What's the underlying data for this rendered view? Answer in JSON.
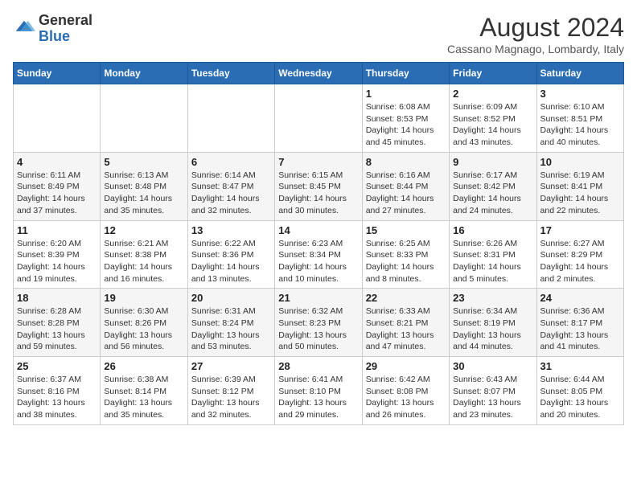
{
  "header": {
    "logo_general": "General",
    "logo_blue": "Blue",
    "month_year": "August 2024",
    "location": "Cassano Magnago, Lombardy, Italy"
  },
  "days_of_week": [
    "Sunday",
    "Monday",
    "Tuesday",
    "Wednesday",
    "Thursday",
    "Friday",
    "Saturday"
  ],
  "weeks": [
    [
      {
        "day": "",
        "info": ""
      },
      {
        "day": "",
        "info": ""
      },
      {
        "day": "",
        "info": ""
      },
      {
        "day": "",
        "info": ""
      },
      {
        "day": "1",
        "info": "Sunrise: 6:08 AM\nSunset: 8:53 PM\nDaylight: 14 hours and 45 minutes."
      },
      {
        "day": "2",
        "info": "Sunrise: 6:09 AM\nSunset: 8:52 PM\nDaylight: 14 hours and 43 minutes."
      },
      {
        "day": "3",
        "info": "Sunrise: 6:10 AM\nSunset: 8:51 PM\nDaylight: 14 hours and 40 minutes."
      }
    ],
    [
      {
        "day": "4",
        "info": "Sunrise: 6:11 AM\nSunset: 8:49 PM\nDaylight: 14 hours and 37 minutes."
      },
      {
        "day": "5",
        "info": "Sunrise: 6:13 AM\nSunset: 8:48 PM\nDaylight: 14 hours and 35 minutes."
      },
      {
        "day": "6",
        "info": "Sunrise: 6:14 AM\nSunset: 8:47 PM\nDaylight: 14 hours and 32 minutes."
      },
      {
        "day": "7",
        "info": "Sunrise: 6:15 AM\nSunset: 8:45 PM\nDaylight: 14 hours and 30 minutes."
      },
      {
        "day": "8",
        "info": "Sunrise: 6:16 AM\nSunset: 8:44 PM\nDaylight: 14 hours and 27 minutes."
      },
      {
        "day": "9",
        "info": "Sunrise: 6:17 AM\nSunset: 8:42 PM\nDaylight: 14 hours and 24 minutes."
      },
      {
        "day": "10",
        "info": "Sunrise: 6:19 AM\nSunset: 8:41 PM\nDaylight: 14 hours and 22 minutes."
      }
    ],
    [
      {
        "day": "11",
        "info": "Sunrise: 6:20 AM\nSunset: 8:39 PM\nDaylight: 14 hours and 19 minutes."
      },
      {
        "day": "12",
        "info": "Sunrise: 6:21 AM\nSunset: 8:38 PM\nDaylight: 14 hours and 16 minutes."
      },
      {
        "day": "13",
        "info": "Sunrise: 6:22 AM\nSunset: 8:36 PM\nDaylight: 14 hours and 13 minutes."
      },
      {
        "day": "14",
        "info": "Sunrise: 6:23 AM\nSunset: 8:34 PM\nDaylight: 14 hours and 10 minutes."
      },
      {
        "day": "15",
        "info": "Sunrise: 6:25 AM\nSunset: 8:33 PM\nDaylight: 14 hours and 8 minutes."
      },
      {
        "day": "16",
        "info": "Sunrise: 6:26 AM\nSunset: 8:31 PM\nDaylight: 14 hours and 5 minutes."
      },
      {
        "day": "17",
        "info": "Sunrise: 6:27 AM\nSunset: 8:29 PM\nDaylight: 14 hours and 2 minutes."
      }
    ],
    [
      {
        "day": "18",
        "info": "Sunrise: 6:28 AM\nSunset: 8:28 PM\nDaylight: 13 hours and 59 minutes."
      },
      {
        "day": "19",
        "info": "Sunrise: 6:30 AM\nSunset: 8:26 PM\nDaylight: 13 hours and 56 minutes."
      },
      {
        "day": "20",
        "info": "Sunrise: 6:31 AM\nSunset: 8:24 PM\nDaylight: 13 hours and 53 minutes."
      },
      {
        "day": "21",
        "info": "Sunrise: 6:32 AM\nSunset: 8:23 PM\nDaylight: 13 hours and 50 minutes."
      },
      {
        "day": "22",
        "info": "Sunrise: 6:33 AM\nSunset: 8:21 PM\nDaylight: 13 hours and 47 minutes."
      },
      {
        "day": "23",
        "info": "Sunrise: 6:34 AM\nSunset: 8:19 PM\nDaylight: 13 hours and 44 minutes."
      },
      {
        "day": "24",
        "info": "Sunrise: 6:36 AM\nSunset: 8:17 PM\nDaylight: 13 hours and 41 minutes."
      }
    ],
    [
      {
        "day": "25",
        "info": "Sunrise: 6:37 AM\nSunset: 8:16 PM\nDaylight: 13 hours and 38 minutes."
      },
      {
        "day": "26",
        "info": "Sunrise: 6:38 AM\nSunset: 8:14 PM\nDaylight: 13 hours and 35 minutes."
      },
      {
        "day": "27",
        "info": "Sunrise: 6:39 AM\nSunset: 8:12 PM\nDaylight: 13 hours and 32 minutes."
      },
      {
        "day": "28",
        "info": "Sunrise: 6:41 AM\nSunset: 8:10 PM\nDaylight: 13 hours and 29 minutes."
      },
      {
        "day": "29",
        "info": "Sunrise: 6:42 AM\nSunset: 8:08 PM\nDaylight: 13 hours and 26 minutes."
      },
      {
        "day": "30",
        "info": "Sunrise: 6:43 AM\nSunset: 8:07 PM\nDaylight: 13 hours and 23 minutes."
      },
      {
        "day": "31",
        "info": "Sunrise: 6:44 AM\nSunset: 8:05 PM\nDaylight: 13 hours and 20 minutes."
      }
    ]
  ]
}
